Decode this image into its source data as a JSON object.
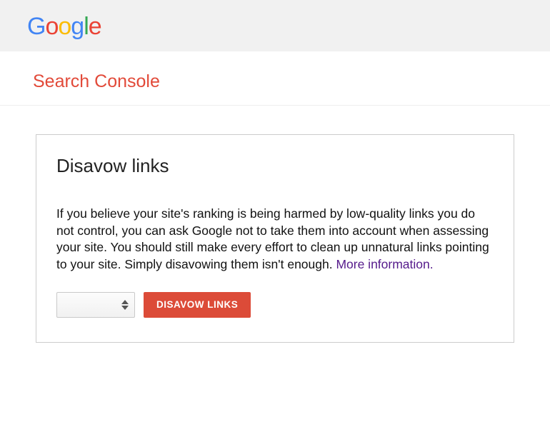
{
  "logo": {
    "g1": "G",
    "o1": "o",
    "o2": "o",
    "g2": "g",
    "l": "l",
    "e": "e"
  },
  "subheader": {
    "title": "Search Console"
  },
  "card": {
    "heading": "Disavow links",
    "body": "If you believe your site's ranking is being harmed by low-quality links you do not control, you can ask Google not to take them into account when assessing your site. You should still make every effort to clean up unnatural links pointing to your site. Simply disavowing them isn't enough. ",
    "more_info": "More information.",
    "button_label": "DISAVOW LINKS",
    "select_value": ""
  },
  "colors": {
    "accent_red": "#dc4b38",
    "link_visited": "#551A8B"
  }
}
